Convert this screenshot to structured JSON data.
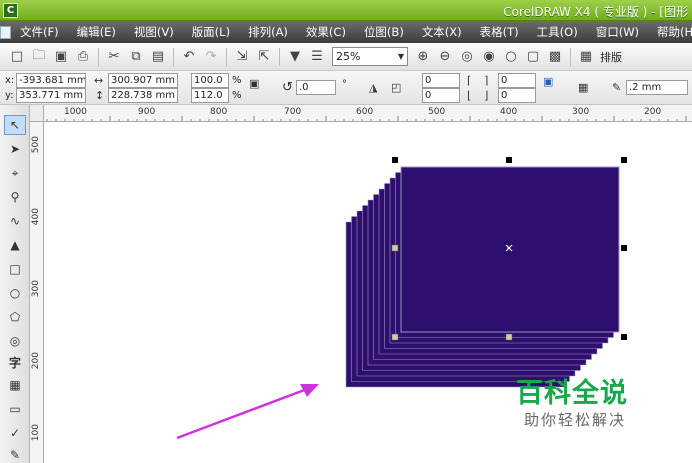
{
  "window": {
    "title": "CorelDRAW X4 ( 专业版 ) - [图形"
  },
  "menu": [
    "文件(F)",
    "编辑(E)",
    "视图(V)",
    "版面(L)",
    "排列(A)",
    "效果(C)",
    "位图(B)",
    "文本(X)",
    "表格(T)",
    "工具(O)",
    "窗口(W)",
    "帮助(H)"
  ],
  "toolbar": {
    "zoom_value": "25%",
    "arrange_label": "排版"
  },
  "props": {
    "x_label": "x:",
    "x_value": "-393.681 mm",
    "y_label": "y:",
    "y_value": "353.771 mm",
    "w_value": "300.907 mm",
    "h_value": "228.738 mm",
    "scale_w": "100.0",
    "scale_h": "112.0",
    "pct": "%",
    "angle_value": ".0",
    "degree": "°",
    "n1": "0",
    "n2": "0",
    "n3": "0",
    "n4": "0",
    "outline_value": ".2 mm"
  },
  "ruler": {
    "h_ticks": [
      "1000",
      "900",
      "800",
      "700",
      "600",
      "500",
      "400",
      "300",
      "200"
    ],
    "v_ticks": [
      "500",
      "400",
      "300",
      "200",
      "100"
    ]
  },
  "watermark": {
    "title": "百科全说",
    "subtitle": "助你轻松解决"
  },
  "colors": {
    "shape_fill": "#2e0f6e",
    "shape_outline": "#9b8fc9",
    "arrow": "#cc33dd",
    "brand_green": "#1aa64b",
    "titlebar": "#7fbd2a"
  }
}
